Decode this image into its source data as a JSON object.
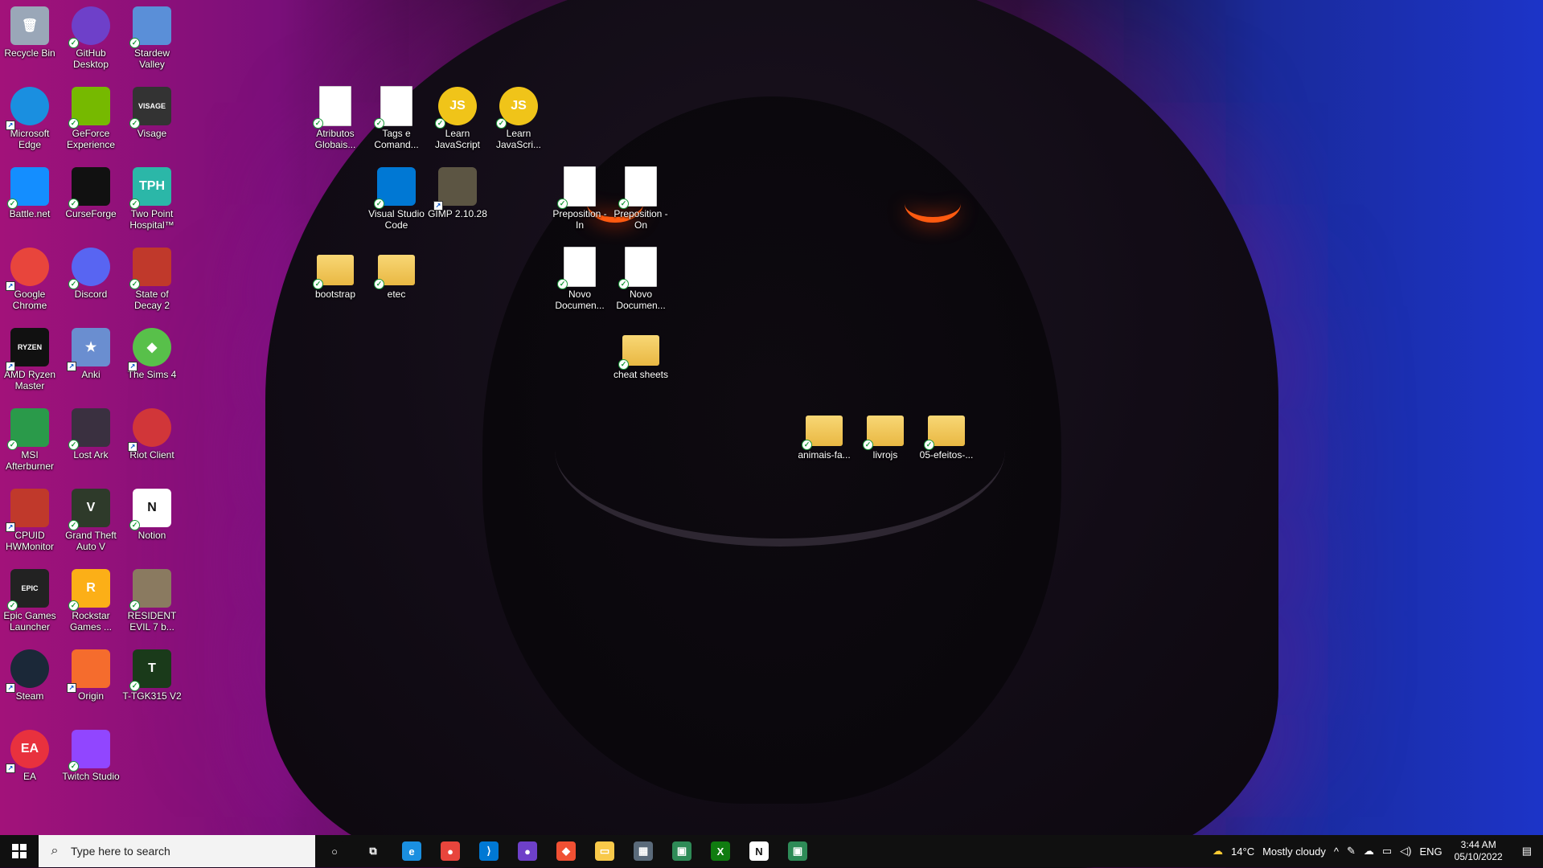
{
  "desktop": {
    "icons": [
      {
        "label": "Recycle Bin",
        "icon": "recycle-bin-icon",
        "color": "#9aa7b8",
        "glyph": "🗑",
        "check": false,
        "shortcut": false
      },
      {
        "label": "GitHub Desktop",
        "icon": "github-icon",
        "color": "#6e40c9",
        "glyph": "",
        "check": true,
        "shortcut": false
      },
      {
        "label": "Stardew Valley",
        "icon": "stardew-valley-icon",
        "color": "#5a8fd8",
        "glyph": "",
        "check": true,
        "shortcut": false
      },
      {
        "label": "Microsoft Edge",
        "icon": "edge-icon",
        "color": "#1a8fe0",
        "glyph": "",
        "check": false,
        "shortcut": true
      },
      {
        "label": "GeForce Experience",
        "icon": "geforce-icon",
        "color": "#76b900",
        "glyph": "",
        "check": true,
        "shortcut": false
      },
      {
        "label": "Visage",
        "icon": "visage-icon",
        "color": "#333333",
        "glyph": "VISAGE",
        "check": true,
        "shortcut": false
      },
      {
        "label": "Battle.net",
        "icon": "battlenet-icon",
        "color": "#148eff",
        "glyph": "",
        "check": true,
        "shortcut": false
      },
      {
        "label": "CurseForge",
        "icon": "curseforge-icon",
        "color": "#111111",
        "glyph": "",
        "check": true,
        "shortcut": false
      },
      {
        "label": "Two Point Hospital™",
        "icon": "two-point-hospital-icon",
        "color": "#2bb7a8",
        "glyph": "TPH",
        "check": true,
        "shortcut": false
      },
      {
        "label": "Google Chrome",
        "icon": "chrome-icon",
        "color": "#e8453c",
        "glyph": "",
        "check": false,
        "shortcut": true
      },
      {
        "label": "Discord",
        "icon": "discord-icon",
        "color": "#5865f2",
        "glyph": "",
        "check": true,
        "shortcut": false
      },
      {
        "label": "State of Decay 2",
        "icon": "state-of-decay-icon",
        "color": "#c0392b",
        "glyph": "",
        "check": true,
        "shortcut": false
      },
      {
        "label": "AMD Ryzen Master",
        "icon": "ryzen-master-icon",
        "color": "#111111",
        "glyph": "RYZEN",
        "check": false,
        "shortcut": true
      },
      {
        "label": "Anki",
        "icon": "anki-icon",
        "color": "#6a8ed0",
        "glyph": "★",
        "check": false,
        "shortcut": true
      },
      {
        "label": "The Sims 4",
        "icon": "sims4-icon",
        "color": "#58c04a",
        "glyph": "◆",
        "check": false,
        "shortcut": true
      },
      {
        "label": "MSI Afterburner",
        "icon": "msi-afterburner-icon",
        "color": "#2a9a4a",
        "glyph": "",
        "check": true,
        "shortcut": false
      },
      {
        "label": "Lost Ark",
        "icon": "lost-ark-icon",
        "color": "#3a3040",
        "glyph": "",
        "check": true,
        "shortcut": false
      },
      {
        "label": "Riot Client",
        "icon": "riot-client-icon",
        "color": "#d13639",
        "glyph": "",
        "check": false,
        "shortcut": true
      },
      {
        "label": "CPUID HWMonitor",
        "icon": "hwmonitor-icon",
        "color": "#c0392b",
        "glyph": "",
        "check": false,
        "shortcut": true
      },
      {
        "label": "Grand Theft Auto V",
        "icon": "gta5-icon",
        "color": "#2e3a2a",
        "glyph": "V",
        "check": true,
        "shortcut": false
      },
      {
        "label": "Notion",
        "icon": "notion-icon",
        "color": "#ffffff",
        "glyph": "N",
        "check": true,
        "shortcut": false
      },
      {
        "label": "Epic Games Launcher",
        "icon": "epic-games-icon",
        "color": "#222222",
        "glyph": "EPIC",
        "check": true,
        "shortcut": false
      },
      {
        "label": "Rockstar Games ...",
        "icon": "rockstar-icon",
        "color": "#fcaf17",
        "glyph": "R",
        "check": true,
        "shortcut": false
      },
      {
        "label": "RESIDENT EVIL 7 b...",
        "icon": "resident-evil-icon",
        "color": "#8a7a60",
        "glyph": "",
        "check": true,
        "shortcut": false
      },
      {
        "label": "Steam",
        "icon": "steam-icon",
        "color": "#1b2838",
        "glyph": "",
        "check": false,
        "shortcut": true
      },
      {
        "label": "Origin",
        "icon": "origin-icon",
        "color": "#f56c2d",
        "glyph": "",
        "check": false,
        "shortcut": true
      },
      {
        "label": "T-TGK315 V2",
        "icon": "t-tgk315-icon",
        "color": "#1a3a1a",
        "glyph": "T",
        "check": true,
        "shortcut": false
      },
      {
        "label": "EA",
        "icon": "ea-icon",
        "color": "#e8313e",
        "glyph": "EA",
        "check": false,
        "shortcut": true
      },
      {
        "label": "Twitch Studio",
        "icon": "twitch-studio-icon",
        "color": "#9146ff",
        "glyph": "",
        "check": true,
        "shortcut": false
      },
      {
        "label": "Atributos Globais...",
        "icon": "document-icon",
        "color": "#ffffff",
        "glyph": "",
        "check": true,
        "shortcut": false,
        "type": "doc"
      },
      {
        "label": "Tags e Comand...",
        "icon": "document-icon",
        "color": "#ffffff",
        "glyph": "",
        "check": true,
        "shortcut": false,
        "type": "doc"
      },
      {
        "label": "Learn JavaScript",
        "icon": "javascript-icon",
        "color": "#f0c419",
        "glyph": "JS",
        "check": true,
        "shortcut": false
      },
      {
        "label": "Learn JavaScri...",
        "icon": "javascript-icon",
        "color": "#f0c419",
        "glyph": "JS",
        "check": true,
        "shortcut": false
      },
      {
        "label": "Visual Studio Code",
        "icon": "vscode-icon",
        "color": "#0078d4",
        "glyph": "",
        "check": true,
        "shortcut": false
      },
      {
        "label": "GIMP 2.10.28",
        "icon": "gimp-icon",
        "color": "#5c5543",
        "glyph": "",
        "check": false,
        "shortcut": true
      },
      {
        "label": "Preposition - In",
        "icon": "document-icon",
        "color": "#ffffff",
        "glyph": "",
        "check": true,
        "shortcut": false,
        "type": "doc"
      },
      {
        "label": "Preposition - On",
        "icon": "document-icon",
        "color": "#ffffff",
        "glyph": "",
        "check": true,
        "shortcut": false,
        "type": "doc"
      },
      {
        "label": "bootstrap",
        "icon": "folder-icon",
        "color": "#f8d775",
        "glyph": "",
        "check": true,
        "shortcut": false,
        "type": "folder"
      },
      {
        "label": "etec",
        "icon": "folder-icon",
        "color": "#f8d775",
        "glyph": "",
        "check": true,
        "shortcut": false,
        "type": "folder"
      },
      {
        "label": "Novo Documen...",
        "icon": "document-icon",
        "color": "#ffffff",
        "glyph": "",
        "check": true,
        "shortcut": false,
        "type": "doc"
      },
      {
        "label": "Novo Documen...",
        "icon": "document-icon",
        "color": "#ffffff",
        "glyph": "",
        "check": true,
        "shortcut": false,
        "type": "doc"
      },
      {
        "label": "cheat sheets",
        "icon": "folder-icon",
        "color": "#f8d775",
        "glyph": "",
        "check": true,
        "shortcut": false,
        "type": "folder"
      },
      {
        "label": "animais-fa...",
        "icon": "folder-icon",
        "color": "#f8d775",
        "glyph": "",
        "check": true,
        "shortcut": false,
        "type": "folder"
      },
      {
        "label": "livrojs",
        "icon": "folder-icon",
        "color": "#f8d775",
        "glyph": "",
        "check": true,
        "shortcut": false,
        "type": "folder"
      },
      {
        "label": "05-efeitos-...",
        "icon": "folder-icon",
        "color": "#f8d775",
        "glyph": "",
        "check": true,
        "shortcut": false,
        "type": "folder"
      }
    ]
  },
  "taskbar": {
    "search_placeholder": "Type here to search",
    "pinned": [
      {
        "name": "cortana-icon",
        "color": "#101010",
        "glyph": "○",
        "open": false
      },
      {
        "name": "task-view-icon",
        "color": "#101010",
        "glyph": "⧉",
        "open": false
      },
      {
        "name": "edge-icon",
        "color": "#1a8fe0",
        "glyph": "e",
        "open": false
      },
      {
        "name": "chrome-icon",
        "color": "#e8453c",
        "glyph": "●",
        "open": false
      },
      {
        "name": "vscode-icon",
        "color": "#0078d4",
        "glyph": "⟩",
        "open": false
      },
      {
        "name": "github-desktop-icon",
        "color": "#6e40c9",
        "glyph": "●",
        "open": false
      },
      {
        "name": "git-icon",
        "color": "#f05033",
        "glyph": "◆",
        "open": false
      },
      {
        "name": "file-explorer-icon",
        "color": "#f8c94a",
        "glyph": "▭",
        "open": false
      },
      {
        "name": "calculator-icon",
        "color": "#5a6a7a",
        "glyph": "▦",
        "open": false
      },
      {
        "name": "store-icon",
        "color": "#2e8b57",
        "glyph": "▣",
        "open": false
      },
      {
        "name": "xbox-icon",
        "color": "#107c10",
        "glyph": "X",
        "open": false
      },
      {
        "name": "notion-icon",
        "color": "#ffffff",
        "glyph": "N",
        "open": false
      },
      {
        "name": "store-2-icon",
        "color": "#2e8b57",
        "glyph": "▣",
        "open": false
      }
    ],
    "weather": {
      "temp": "14°C",
      "condition": "Mostly cloudy"
    },
    "language": "ENG",
    "clock": {
      "time": "3:44 AM",
      "date": "05/10/2022"
    }
  }
}
